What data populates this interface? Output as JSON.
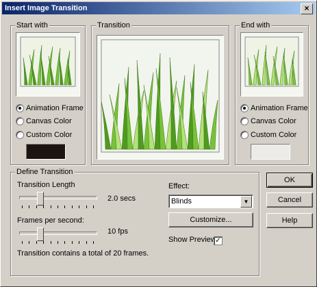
{
  "title": "Insert Image Transition",
  "start_with": {
    "label": "Start with",
    "options": [
      "Animation Frame",
      "Canvas Color",
      "Custom Color"
    ],
    "selected": 0,
    "custom_color": "#1c140e"
  },
  "transition": {
    "label": "Transition"
  },
  "end_with": {
    "label": "End with",
    "options": [
      "Animation Frame",
      "Canvas Color",
      "Custom Color"
    ],
    "selected": 0,
    "custom_color": "#ecebe8"
  },
  "define": {
    "label": "Define Transition",
    "length_label": "Transition Length",
    "length_value": "2.0 secs",
    "length_level": 0.25,
    "fps_label": "Frames per second:",
    "fps_value": "10 fps",
    "fps_level": 0.25,
    "summary": "Transition contains a total of 20 frames.",
    "effect_label": "Effect:",
    "effect_value": "Blinds",
    "customize_label": "Customize...",
    "show_preview_label": "Show Preview",
    "show_preview_checked": true
  },
  "buttons": {
    "ok": "OK",
    "cancel": "Cancel",
    "help": "Help"
  },
  "colors": {
    "grass_dark": "#4f9a1f",
    "grass_mid": "#78c23a",
    "grass_light": "#b6e07a",
    "title_start": "#0a246a",
    "title_end": "#a6caf0"
  }
}
